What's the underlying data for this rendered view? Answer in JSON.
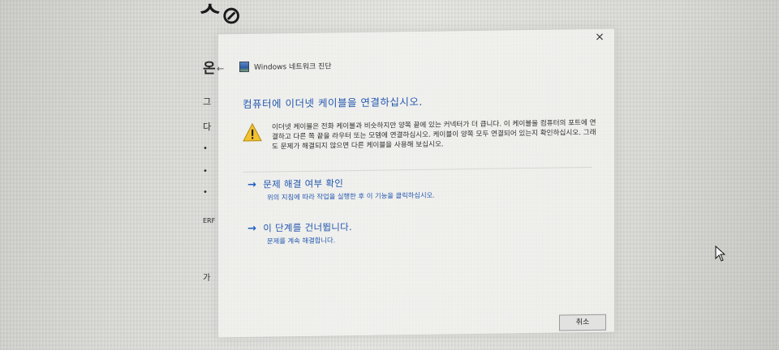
{
  "background": {
    "top_glyph": "ᄉ⊘",
    "side_labels": [
      "온",
      "그",
      "다",
      "•",
      "•",
      "•",
      "ERF",
      "가"
    ]
  },
  "dialog": {
    "close_label": "×",
    "back_label": "←",
    "app_title": "Windows 네트워크 진단",
    "heading": "컴퓨터에 이더넷 케이블을 연결하십시오.",
    "warning_text": "이더넷 케이블은 전화 케이블과 비슷하지만 양쪽 끝에 있는 커넥터가 더 큽니다. 이 케이블을 컴퓨터의 포트에 연결하고 다른 쪽 끝을 라우터 또는 모뎀에 연결하십시오. 케이블이 양쪽 모두 연결되어 있는지 확인하십시오. 그래도 문제가 해결되지 않으면 다른 케이블을 사용해 보십시오.",
    "options": [
      {
        "title": "문제 해결 여부 확인",
        "description": "위의 지침에 따라 작업을 실행한 후 이 기능을 클릭하십시오."
      },
      {
        "title": "이 단계를 건너뜁니다.",
        "description": "문제를 계속 해결합니다."
      }
    ],
    "cancel_label": "취소"
  },
  "colors": {
    "accent": "#2458b0",
    "warning": "#f2c12e"
  },
  "icons": {
    "app": "network-diagnostics-icon",
    "warning": "warning-triangle-icon",
    "arrow": "right-arrow-icon",
    "close": "close-icon",
    "cursor": "mouse-pointer-icon"
  }
}
